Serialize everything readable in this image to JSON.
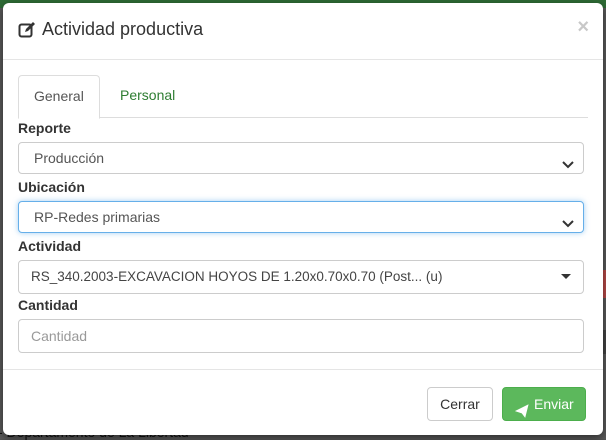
{
  "backdrop": {
    "bottom_text": "- Departamento de La Libertad"
  },
  "modal": {
    "title": "Actividad productiva",
    "title_icon": "edit-icon",
    "close_symbol": "×",
    "tabs": [
      {
        "label": "General",
        "active": true
      },
      {
        "label": "Personal",
        "active": false
      }
    ],
    "fields": {
      "reporte": {
        "label": "Reporte",
        "value": "Producción"
      },
      "ubicacion": {
        "label": "Ubicación",
        "value": "RP-Redes primarias"
      },
      "actividad": {
        "label": "Actividad",
        "value": "RS_340.2003-EXCAVACION HOYOS DE 1.20x0.70x0.70 (Post... (u)"
      },
      "cantidad": {
        "label": "Cantidad",
        "placeholder": "Cantidad"
      }
    },
    "buttons": {
      "cancel": "Cerrar",
      "send": "Enviar"
    }
  },
  "colors": {
    "accent_green": "#5cb85c",
    "tab_link_green": "#2e7d32",
    "focus_blue": "#66afe9"
  }
}
